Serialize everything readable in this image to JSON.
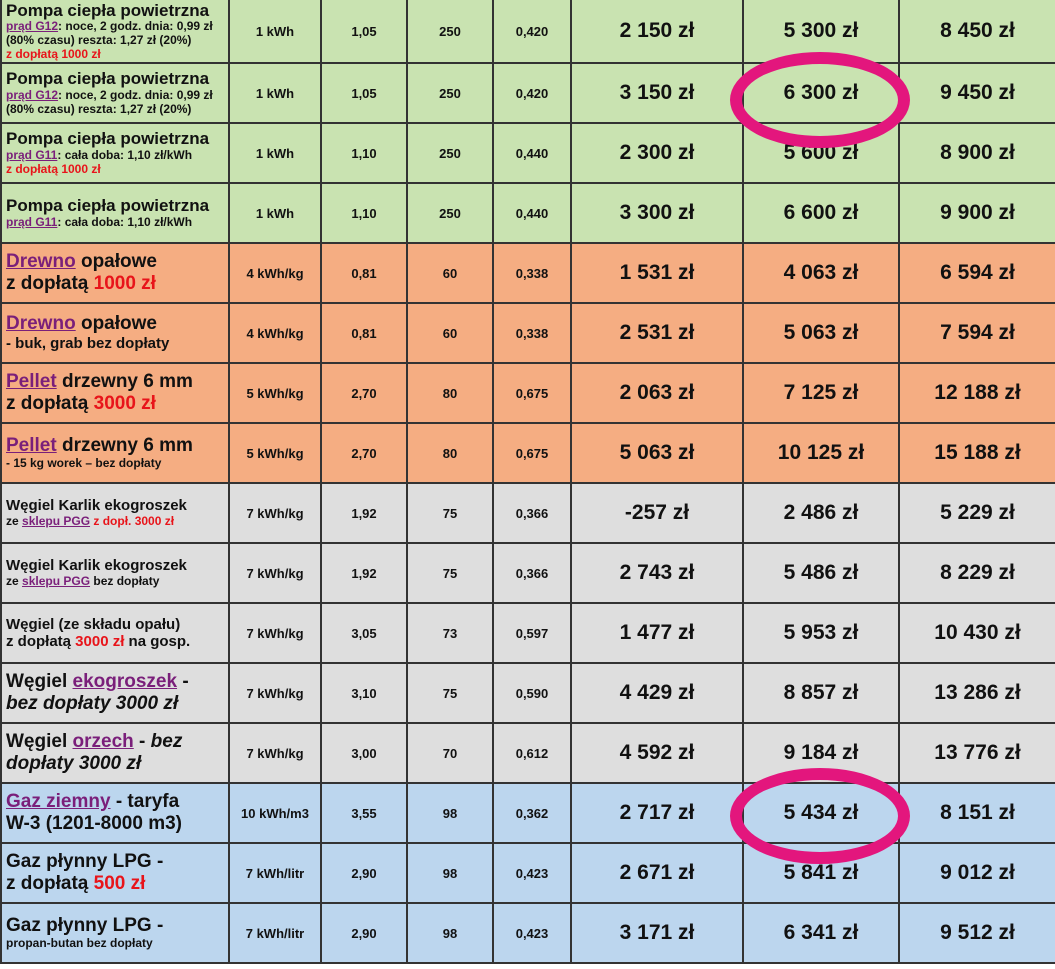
{
  "rows": [
    {
      "name": "Pompa ciepła powietrzna",
      "desc_link": "prąd G12",
      "desc_text": ": noce, 2 godz. dnia: 0,99 zł (80% czasu) reszta: 1,27 zł (20%)",
      "desc_red": "z dopłatą 1000 zł",
      "unit": "1 kWh",
      "price": "1,05",
      "eff": "250",
      "kwh": "0,420",
      "c1": "2 150 zł",
      "c2": "5 300 zł",
      "c3": "8 450 zł"
    },
    {
      "name": "Pompa ciepła powietrzna",
      "desc_link": "prąd G12",
      "desc_text": ": noce, 2 godz. dnia: 0,99 zł (80% czasu) reszta: 1,27 zł (20%)",
      "unit": "1 kWh",
      "price": "1,05",
      "eff": "250",
      "kwh": "0,420",
      "c1": "3 150 zł",
      "c2": "6 300 zł",
      "c3": "9 450 zł"
    },
    {
      "name": "Pompa ciepła powietrzna",
      "desc_link": "prąd G11",
      "desc_text": ": cała doba: 1,10 zł/kWh",
      "desc_red": "z dopłatą 1000 zł",
      "unit": "1 kWh",
      "price": "1,10",
      "eff": "250",
      "kwh": "0,440",
      "c1": "2 300 zł",
      "c2": "5 600 zł",
      "c3": "8 900 zł"
    },
    {
      "name": "Pompa ciepła powietrzna",
      "desc_link": "prąd G11",
      "desc_text": ": cała doba: 1,10 zł/kWh",
      "unit": "1 kWh",
      "price": "1,10",
      "eff": "250",
      "kwh": "0,440",
      "c1": "3 300 zł",
      "c2": "6 600 zł",
      "c3": "9 900 zł"
    },
    {
      "name_link": "Drewno",
      "name_rest": " opałowe",
      "line2_text": "z dopłatą ",
      "line2_red": "1000 zł",
      "unit": "4 kWh/kg",
      "price": "0,81",
      "eff": "60",
      "kwh": "0,338",
      "c1": "1 531 zł",
      "c2": "4 063 zł",
      "c3": "6 594 zł"
    },
    {
      "name_link": "Drewno",
      "name_rest": " opałowe",
      "line2_text": "- buk, grab bez dopłaty",
      "unit": "4 kWh/kg",
      "price": "0,81",
      "eff": "60",
      "kwh": "0,338",
      "c1": "2 531 zł",
      "c2": "5 063 zł",
      "c3": "7 594 zł"
    },
    {
      "name_link": "Pellet",
      "name_rest": " drzewny 6 mm",
      "line2_text": "z dopłatą ",
      "line2_red": "3000 zł",
      "unit": "5 kWh/kg",
      "price": "2,70",
      "eff": "80",
      "kwh": "0,675",
      "c1": "2 063 zł",
      "c2": "7 125 zł",
      "c3": "12 188 zł"
    },
    {
      "name_link": "Pellet",
      "name_rest": " drzewny 6 mm",
      "line2_text": "- 15 kg worek – bez dopłaty",
      "unit": "5 kWh/kg",
      "price": "2,70",
      "eff": "80",
      "kwh": "0,675",
      "c1": "5 063 zł",
      "c2": "10 125 zł",
      "c3": "15 188 zł"
    },
    {
      "name": "Węgiel Karlik ekogroszek",
      "line2_pre": "ze ",
      "line2_link": "sklepu PGG",
      "line2_red": " z dopł. 3000 zł",
      "unit": "7 kWh/kg",
      "price": "1,92",
      "eff": "75",
      "kwh": "0,366",
      "c1": "-257 zł",
      "c2": "2 486 zł",
      "c3": "5 229 zł"
    },
    {
      "name": "Węgiel Karlik ekogroszek",
      "line2_pre": "ze ",
      "line2_link": "sklepu PGG",
      "line2_post": " bez dopłaty",
      "unit": "7 kWh/kg",
      "price": "1,92",
      "eff": "75",
      "kwh": "0,366",
      "c1": "2 743 zł",
      "c2": "5 486 zł",
      "c3": "8 229 zł"
    },
    {
      "name": "Węgiel (ze składu opału)",
      "line2_pre": "z dopłatą ",
      "line2_red": "3000 zł",
      "line2_post": " na gosp.",
      "unit": "7 kWh/kg",
      "price": "3,05",
      "eff": "73",
      "kwh": "0,597",
      "c1": "1 477 zł",
      "c2": "5 953 zł",
      "c3": "10 430 zł"
    },
    {
      "name_pre": "Węgiel ",
      "name_link": "ekogroszek",
      "name_post": " -",
      "line2_italic": "bez dopłaty 3000 zł",
      "unit": "7 kWh/kg",
      "price": "3,10",
      "eff": "75",
      "kwh": "0,590",
      "c1": "4 429 zł",
      "c2": "8 857 zł",
      "c3": "13 286 zł"
    },
    {
      "name_pre": "Węgiel ",
      "name_link": "orzech",
      "name_post": " - ",
      "name_italic": "bez",
      "line2_italic": "dopłaty 3000 zł",
      "unit": "7 kWh/kg",
      "price": "3,00",
      "eff": "70",
      "kwh": "0,612",
      "c1": "4 592 zł",
      "c2": "9 184 zł",
      "c3": "13 776 zł"
    },
    {
      "name_link": "Gaz ziemny",
      "name_rest": " - taryfa",
      "line2_text": "W-3 (1201-8000 m3)",
      "unit": "10 kWh/m3",
      "price": "3,55",
      "eff": "98",
      "kwh": "0,362",
      "c1": "2 717 zł",
      "c2": "5 434 zł",
      "c3": "8 151 zł"
    },
    {
      "name": "Gaz płynny LPG -",
      "line2_text": "z dopłatą ",
      "line2_red": "500 zł",
      "unit": "7 kWh/litr",
      "price": "2,90",
      "eff": "98",
      "kwh": "0,423",
      "c1": "2 671 zł",
      "c2": "5 841 zł",
      "c3": "9 012 zł"
    },
    {
      "name": "Gaz płynny LPG -",
      "line2_text": "propan-butan bez dopłaty",
      "unit": "7 kWh/litr",
      "price": "2,90",
      "eff": "98",
      "kwh": "0,423",
      "c1": "3 171 zł",
      "c2": "6 341 zł",
      "c3": "9 512 zł"
    }
  ],
  "colors": {
    "green": "#c9e3b1",
    "orange": "#f5ad82",
    "gray": "#dedede",
    "blue": "#bcd6ee",
    "highlight": "#e3167d",
    "red": "#e8141a",
    "link": "#7a1f7a"
  }
}
